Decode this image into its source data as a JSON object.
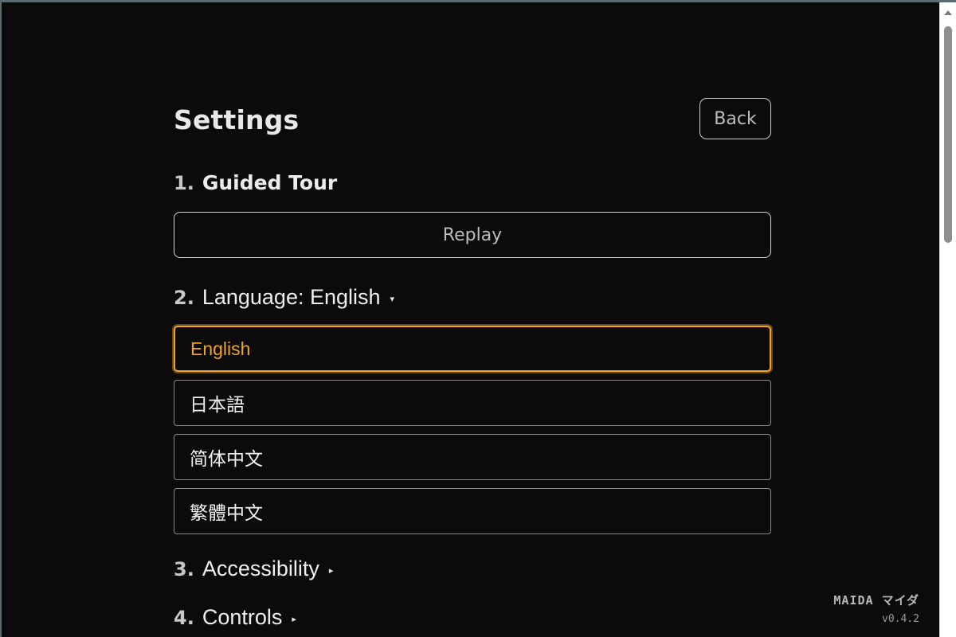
{
  "settings": {
    "title": "Settings",
    "back_label": "Back"
  },
  "sections": {
    "tour": {
      "number": "1.",
      "label": "Guided Tour",
      "replay_label": "Replay"
    },
    "language": {
      "number": "2.",
      "label": "Language: English",
      "caret": "▾",
      "options": [
        {
          "label": "English",
          "selected": true
        },
        {
          "label": "日本語",
          "selected": false
        },
        {
          "label": "简体中文",
          "selected": false
        },
        {
          "label": "繁體中文",
          "selected": false
        }
      ]
    },
    "accessibility": {
      "number": "3.",
      "label": "Accessibility",
      "caret": "▸"
    },
    "controls": {
      "number": "4.",
      "label": "Controls",
      "caret": "▸"
    }
  },
  "brand": {
    "name": "MAIDA マイダ",
    "version": "v0.4.2"
  },
  "colors": {
    "background": "#0b0b0b",
    "accent": "#f0a32a",
    "text": "#e8e8e8"
  }
}
